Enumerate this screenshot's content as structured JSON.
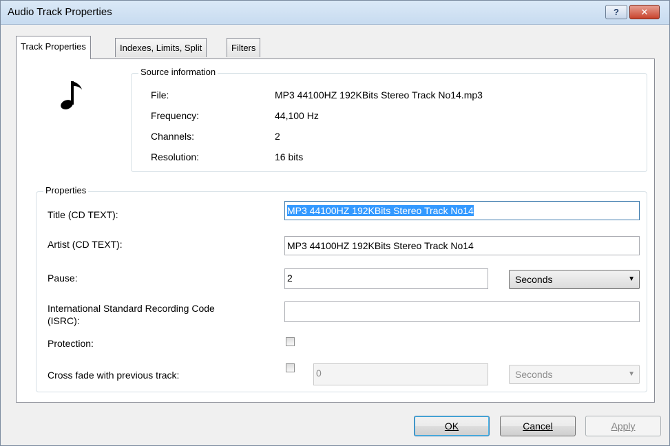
{
  "window": {
    "title": "Audio Track Properties",
    "help_label": "?",
    "close_label": "✕"
  },
  "tabs": [
    {
      "label": "Track Properties",
      "active": true
    },
    {
      "label": "Indexes, Limits, Split",
      "active": false
    },
    {
      "label": "Filters",
      "active": false
    }
  ],
  "icon": "music-note-icon",
  "source": {
    "group_label": "Source information",
    "rows": [
      {
        "label": "File:",
        "value": "MP3 44100HZ 192KBits Stereo Track No14.mp3"
      },
      {
        "label": "Frequency:",
        "value": "44,100 Hz"
      },
      {
        "label": "Channels:",
        "value": "2"
      },
      {
        "label": "Resolution:",
        "value": "16 bits"
      }
    ]
  },
  "properties": {
    "group_label": "Properties",
    "title_label": "Title (CD TEXT):",
    "title_value": "MP3 44100HZ 192KBits Stereo Track No14",
    "artist_label": "Artist (CD TEXT):",
    "artist_value": "MP3 44100HZ 192KBits Stereo Track No14",
    "pause_label": "Pause:",
    "pause_value": "2",
    "pause_unit": "Seconds",
    "isrc_label_line1": "International Standard Recording Code",
    "isrc_label_line2": "(ISRC):",
    "isrc_value": "",
    "protection_label": "Protection:",
    "protection_checked": false,
    "crossfade_label": "Cross fade with previous track:",
    "crossfade_checked": false,
    "crossfade_value": "0",
    "crossfade_unit": "Seconds"
  },
  "buttons": {
    "ok": "OK",
    "cancel": "Cancel",
    "apply": "Apply"
  },
  "colors": {
    "selection": "#3399ff",
    "close_button": "#c8432c",
    "titlebar": "#dbe9f7"
  }
}
